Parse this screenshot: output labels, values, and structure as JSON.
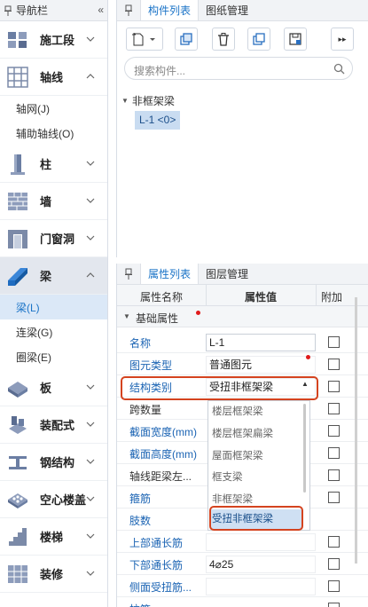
{
  "nav": {
    "title": "导航栏",
    "categories": [
      {
        "label": "施工段",
        "icon": "construction-stage-icon"
      },
      {
        "label": "轴线",
        "icon": "grid-icon"
      },
      {
        "label": "柱",
        "icon": "column-icon"
      },
      {
        "label": "墙",
        "icon": "wall-icon"
      },
      {
        "label": "门窗洞",
        "icon": "door-window-icon"
      },
      {
        "label": "梁",
        "icon": "beam-icon"
      },
      {
        "label": "板",
        "icon": "slab-icon"
      },
      {
        "label": "装配式",
        "icon": "prefab-icon"
      },
      {
        "label": "钢结构",
        "icon": "steel-icon"
      },
      {
        "label": "空心楼盖",
        "icon": "hollow-floor-icon"
      },
      {
        "label": "楼梯",
        "icon": "stair-icon"
      },
      {
        "label": "装修",
        "icon": "decoration-icon"
      }
    ],
    "axis_subitems": [
      "轴网(J)",
      "辅助轴线(O)"
    ],
    "beam_subitems": [
      "梁(L)",
      "连梁(G)",
      "圈梁(E)"
    ]
  },
  "component_panel": {
    "tabs": [
      "构件列表",
      "图纸管理"
    ],
    "search_placeholder": "搜索构件...",
    "tree_node": "非框架梁",
    "tree_leaf": "L-1 <0>"
  },
  "property_panel": {
    "tabs": [
      "属性列表",
      "图层管理"
    ],
    "col_name": "属性名称",
    "col_value": "属性值",
    "col_extra": "附加",
    "group": "基础属性",
    "rows": [
      {
        "name": "名称",
        "value": "L-1"
      },
      {
        "name": "图元类型",
        "value": "普通图元"
      },
      {
        "name": "结构类别",
        "value": "受扭非框架梁"
      },
      {
        "name": "跨数量",
        "value": ""
      },
      {
        "name": "截面宽度(mm)",
        "value": ""
      },
      {
        "name": "截面高度(mm)",
        "value": ""
      },
      {
        "name": "轴线距梁左...",
        "value": ""
      },
      {
        "name": "箍筋",
        "value": ""
      },
      {
        "name": "肢数",
        "value": ""
      },
      {
        "name": "上部通长筋",
        "value": ""
      },
      {
        "name": "下部通长筋",
        "value": "4⌀25"
      },
      {
        "name": "侧面受扭筋...",
        "value": ""
      },
      {
        "name": "拉筋",
        "value": ""
      }
    ],
    "dropdown_options": [
      "楼层框架梁",
      "楼层框架扁梁",
      "屋面框架梁",
      "框支梁",
      "非框架梁",
      "受扭非框架梁"
    ],
    "dropdown_selected": "受扭非框架梁"
  },
  "colors": {
    "accent": "#1a73c7",
    "highlight_outline": "#d4431f"
  }
}
